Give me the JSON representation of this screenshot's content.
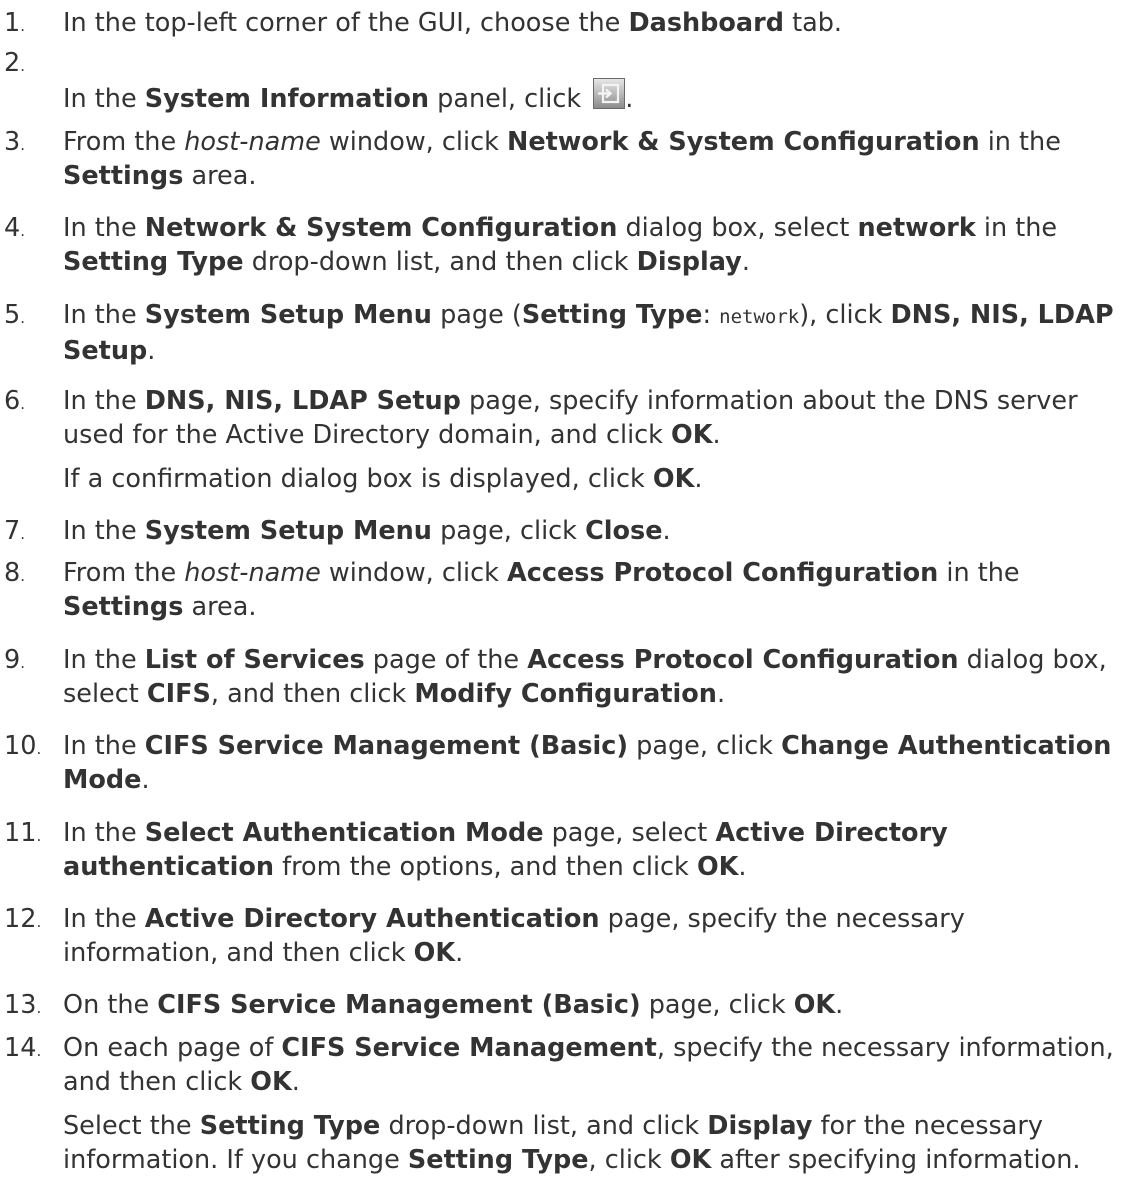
{
  "steps": [
    {
      "number": "1",
      "paragraphs": [
        [
          {
            "t": "In the top-left corner of the GUI, choose the "
          },
          {
            "t": "Dashboard",
            "b": true
          },
          {
            "t": " tab."
          }
        ]
      ]
    },
    {
      "number": "2",
      "paragraphs": [
        [
          {
            "t": "In the "
          },
          {
            "t": "System Information",
            "b": true
          },
          {
            "t": " panel, click "
          },
          {
            "icon": "export-arrow-icon"
          },
          {
            "t": "."
          }
        ]
      ]
    },
    {
      "number": "3",
      "paragraphs": [
        [
          {
            "t": "From the "
          },
          {
            "t": "host-name",
            "i": true
          },
          {
            "t": " window, click "
          },
          {
            "t": "Network & System Configuration",
            "b": true
          },
          {
            "t": " in the "
          },
          {
            "t": "Settings",
            "b": true
          },
          {
            "t": " area."
          }
        ]
      ]
    },
    {
      "number": "4",
      "paragraphs": [
        [
          {
            "t": "In the "
          },
          {
            "t": "Network & System Configuration",
            "b": true
          },
          {
            "t": " dialog box, select "
          },
          {
            "t": "network",
            "b": true
          },
          {
            "t": " in the "
          },
          {
            "t": "Setting Type",
            "b": true
          },
          {
            "t": " drop-down list, and then click "
          },
          {
            "t": "Display",
            "b": true
          },
          {
            "t": "."
          }
        ]
      ]
    },
    {
      "number": "5",
      "paragraphs": [
        [
          {
            "t": "In the "
          },
          {
            "t": "System Setup Menu",
            "b": true
          },
          {
            "t": " page ("
          },
          {
            "t": "Setting Type",
            "b": true
          },
          {
            "t": ": "
          },
          {
            "t": "network",
            "code": true
          },
          {
            "t": "), click "
          },
          {
            "t": "DNS, NIS, LDAP Setup",
            "b": true
          },
          {
            "t": "."
          }
        ]
      ]
    },
    {
      "number": "6",
      "paragraphs": [
        [
          {
            "t": "In the "
          },
          {
            "t": "DNS, NIS, LDAP Setup",
            "b": true
          },
          {
            "t": " page, specify information about the DNS server used for the Active Directory domain, and click "
          },
          {
            "t": "OK",
            "b": true
          },
          {
            "t": "."
          }
        ],
        [
          {
            "t": "If a confirmation dialog box is displayed, click "
          },
          {
            "t": "OK",
            "b": true
          },
          {
            "t": "."
          }
        ]
      ]
    },
    {
      "number": "7",
      "paragraphs": [
        [
          {
            "t": "In the "
          },
          {
            "t": "System Setup Menu",
            "b": true
          },
          {
            "t": " page, click "
          },
          {
            "t": "Close",
            "b": true
          },
          {
            "t": "."
          }
        ]
      ]
    },
    {
      "number": "8",
      "paragraphs": [
        [
          {
            "t": "From the "
          },
          {
            "t": "host-name",
            "i": true
          },
          {
            "t": " window, click "
          },
          {
            "t": "Access Protocol Configuration",
            "b": true
          },
          {
            "t": " in the "
          },
          {
            "t": "Settings",
            "b": true
          },
          {
            "t": " area."
          }
        ]
      ]
    },
    {
      "number": "9",
      "paragraphs": [
        [
          {
            "t": "In the "
          },
          {
            "t": "List of Services",
            "b": true
          },
          {
            "t": " page of the "
          },
          {
            "t": "Access Protocol Configuration",
            "b": true
          },
          {
            "t": " dialog box, select "
          },
          {
            "t": "CIFS",
            "b": true
          },
          {
            "t": ", and then click "
          },
          {
            "t": "Modify Configuration",
            "b": true
          },
          {
            "t": "."
          }
        ]
      ]
    },
    {
      "number": "10",
      "paragraphs": [
        [
          {
            "t": "In the "
          },
          {
            "t": "CIFS Service Management (Basic)",
            "b": true
          },
          {
            "t": " page, click "
          },
          {
            "t": "Change Authentication Mode",
            "b": true
          },
          {
            "t": "."
          }
        ]
      ]
    },
    {
      "number": "11",
      "paragraphs": [
        [
          {
            "t": "In the "
          },
          {
            "t": "Select Authentication Mode",
            "b": true
          },
          {
            "t": " page, select "
          },
          {
            "t": "Active Directory authentication",
            "b": true
          },
          {
            "t": " from the options, and then click "
          },
          {
            "t": "OK",
            "b": true
          },
          {
            "t": "."
          }
        ]
      ]
    },
    {
      "number": "12",
      "paragraphs": [
        [
          {
            "t": "In the "
          },
          {
            "t": "Active Directory Authentication",
            "b": true
          },
          {
            "t": " page, specify the necessary information, and then click "
          },
          {
            "t": "OK",
            "b": true
          },
          {
            "t": "."
          }
        ]
      ]
    },
    {
      "number": "13",
      "paragraphs": [
        [
          {
            "t": "On the "
          },
          {
            "t": "CIFS Service Management (Basic)",
            "b": true
          },
          {
            "t": " page, click "
          },
          {
            "t": "OK",
            "b": true
          },
          {
            "t": "."
          }
        ]
      ]
    },
    {
      "number": "14",
      "paragraphs": [
        [
          {
            "t": "On each page of "
          },
          {
            "t": "CIFS Service Management",
            "b": true
          },
          {
            "t": ", specify the necessary information, and then click "
          },
          {
            "t": "OK",
            "b": true
          },
          {
            "t": "."
          }
        ],
        [
          {
            "t": "Select the "
          },
          {
            "t": "Setting Type",
            "b": true
          },
          {
            "t": " drop-down list, and click "
          },
          {
            "t": "Display",
            "b": true
          },
          {
            "t": " for the necessary information. If you change "
          },
          {
            "t": "Setting Type",
            "b": true
          },
          {
            "t": ", click "
          },
          {
            "t": "OK",
            "b": true
          },
          {
            "t": " after specifying information."
          }
        ]
      ]
    }
  ]
}
